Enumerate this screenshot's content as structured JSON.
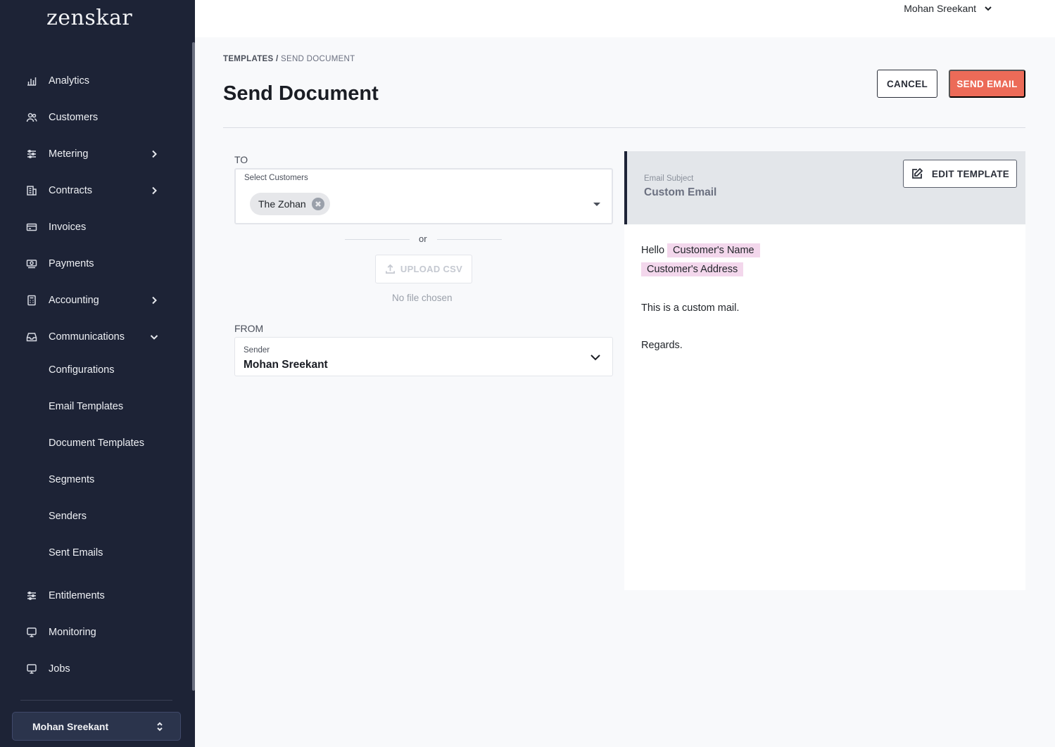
{
  "app": {
    "logo": "zenskar"
  },
  "sidebar": {
    "items": [
      {
        "label": "Analytics",
        "icon": "bar-chart-icon",
        "expandable": false
      },
      {
        "label": "Customers",
        "icon": "users-icon",
        "expandable": false
      },
      {
        "label": "Metering",
        "icon": "sliders-icon",
        "expandable": true,
        "expanded": false
      },
      {
        "label": "Contracts",
        "icon": "building-icon",
        "expandable": true,
        "expanded": false
      },
      {
        "label": "Invoices",
        "icon": "credit-card-icon",
        "expandable": false
      },
      {
        "label": "Payments",
        "icon": "cash-icon",
        "expandable": false
      },
      {
        "label": "Accounting",
        "icon": "calculator-icon",
        "expandable": true,
        "expanded": false
      },
      {
        "label": "Communications",
        "icon": "inbox-icon",
        "expandable": true,
        "expanded": true
      },
      {
        "label": "Entitlements",
        "icon": "sliders-icon",
        "expandable": false
      },
      {
        "label": "Monitoring",
        "icon": "monitor-icon",
        "expandable": false
      },
      {
        "label": "Jobs",
        "icon": "monitor-icon",
        "expandable": false
      }
    ],
    "communications_sub": [
      "Configurations",
      "Email Templates",
      "Document Templates",
      "Segments",
      "Senders",
      "Sent Emails"
    ],
    "user": "Mohan Sreekant"
  },
  "topbar": {
    "user": "Mohan Sreekant"
  },
  "header": {
    "breadcrumb": [
      "TEMPLATES",
      "SEND DOCUMENT"
    ],
    "separator": "/",
    "title": "Send Document",
    "cancel_label": "CANCEL",
    "send_label": "SEND EMAIL"
  },
  "form": {
    "to_label": "TO",
    "customers_label": "Select Customers",
    "selected_customers": [
      "The Zohan"
    ],
    "or_text": "or",
    "upload_label": "UPLOAD CSV",
    "no_file_text": "No file chosen",
    "from_label": "FROM",
    "sender_label": "Sender",
    "sender_value": "Mohan Sreekant"
  },
  "preview": {
    "subject_label": "Email Subject",
    "subject_value": "Custom Email",
    "edit_label": "EDIT TEMPLATE",
    "greeting": "Hello",
    "tag_name": "Customer's Name",
    "tag_address": "Customer's Address",
    "body_line": "This is a custom mail.",
    "closing": "Regards."
  },
  "colors": {
    "sidebar_bg": "#1d2336",
    "accent": "#ec6b58",
    "tag_bg": "#f3d7ec"
  }
}
